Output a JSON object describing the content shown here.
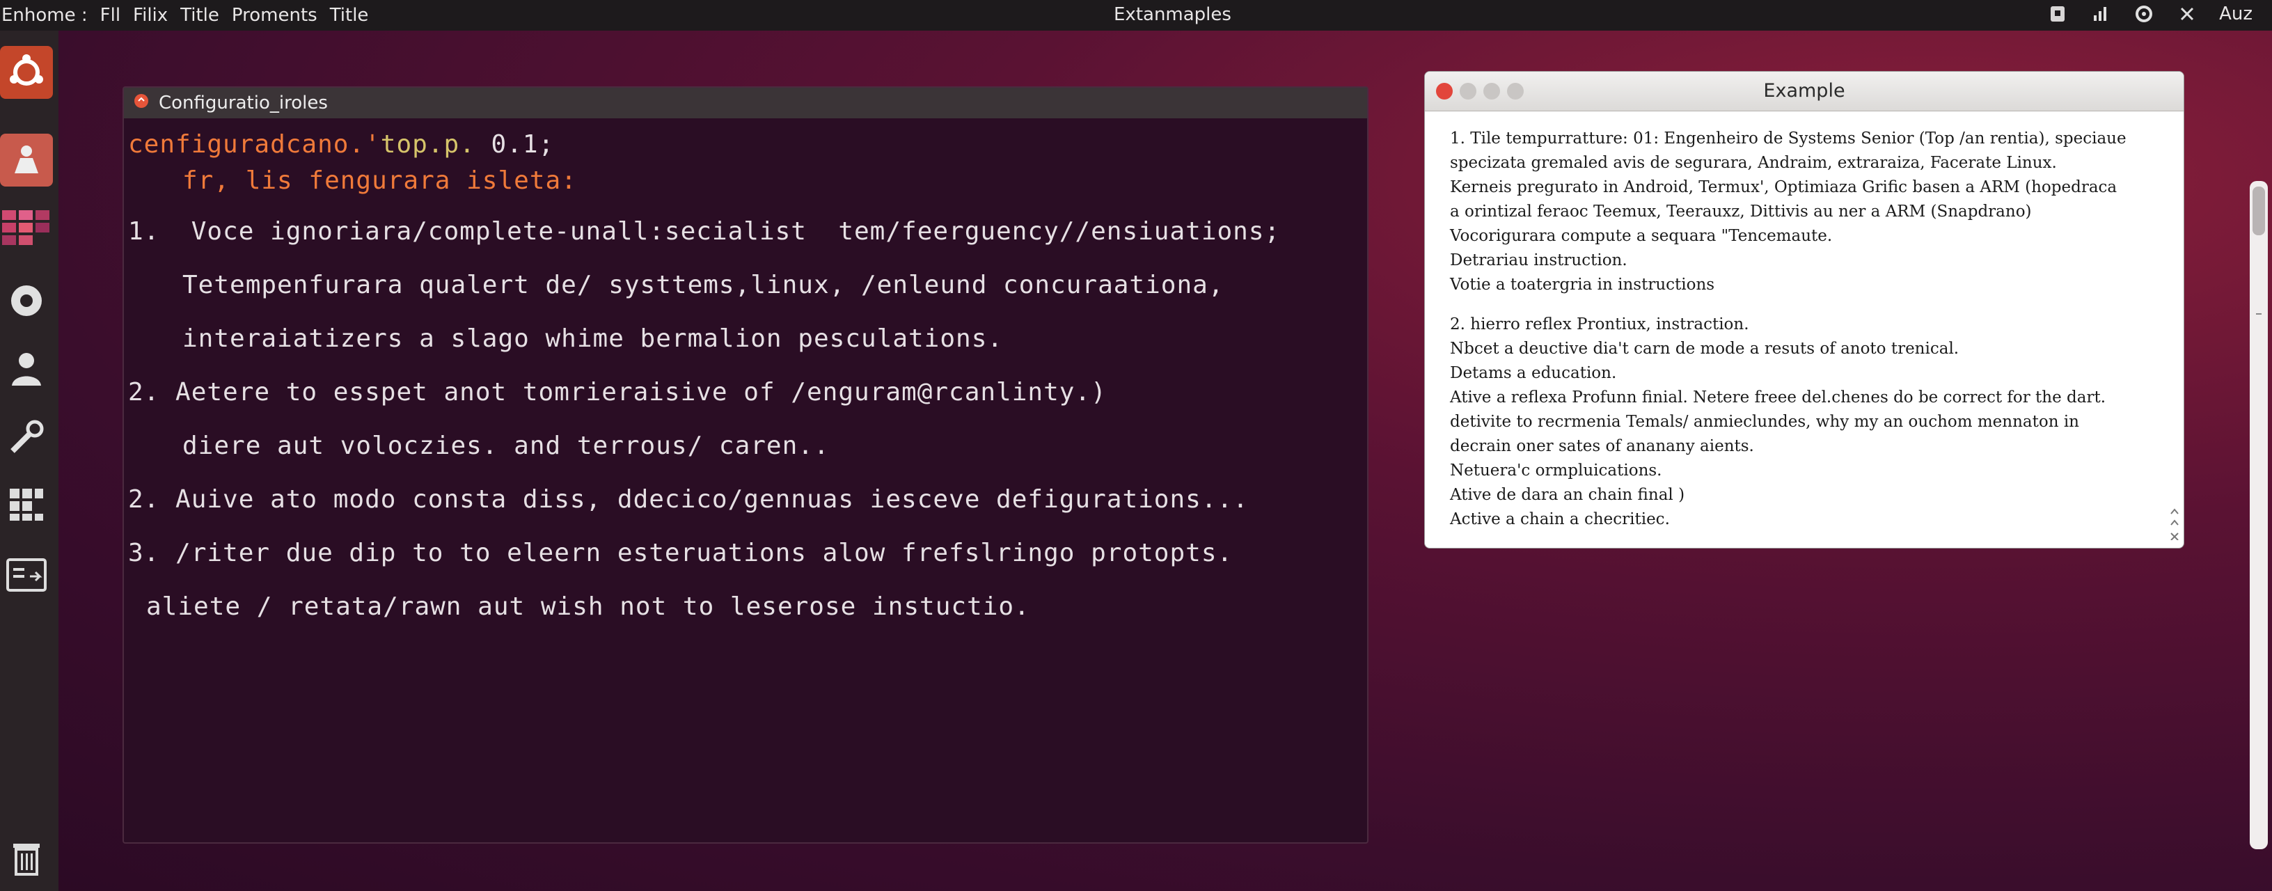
{
  "topbar": {
    "menu": [
      "Enhome :",
      "Fll",
      "Filix",
      "Title",
      "Proments",
      "Title"
    ],
    "center_title": "Extanmaples",
    "status_right": "Auz",
    "icons": [
      "dropbox-icon",
      "network-icon",
      "settings-icon",
      "close-icon"
    ]
  },
  "dock": {
    "items": [
      "ubuntu-logo-icon",
      "installer-icon",
      "apps-grid-icon",
      "settings-icon",
      "user-icon",
      "tools-icon",
      "blocks-icon",
      "files-icon",
      "trash-icon"
    ]
  },
  "terminal": {
    "title": "Configuratio_iroles",
    "lines": [
      {
        "a": "cenfiguradcano.'",
        "b": "top.p.",
        "c": " 0.1;"
      },
      "fr, lis fengurara isleta:",
      "1.  Voce ignoriara/complete-unall:secialist  tem/feerguency//ensiuations;",
      "Tetempenfurara qualert de/ systtems,linux, /enleund concuraationa,",
      "interaiatizers a slago whime bermalion pesculations.",
      "2. Aetere to esspet anot tomrieraisive of /enguram@rcanlinty.)",
      "diere aut voloczies. and terrous/ caren..",
      "2. Auive ato modo consta diss, ddecico/gennuas iesceve defigurations...",
      "3. /riter due dip to to eleern esteruations alow frefslringo protopts.",
      "aliete / retata/rawn aut wish not to leserose instuctio."
    ]
  },
  "example": {
    "title": "Example",
    "para1": [
      "1. Tile tempurratture: 01: Engenheiro de Systems Senior (Top /an rentia), speciaue",
      "specizata gremaled avis de segurara, Andraim, extraraiza, Facerate Linux.",
      "Kerneis pregurato in Android, Termux', Optimiaza Grific basen a ARM (hopedraca",
      "a orintizal feraoc Teemux, Teerauxz, Dittivis au ner a ARM (Snapdrano)",
      "Vocorigurara compute a sequara \"Tencemaute.",
      "Detrariau instruction.",
      "Votie a toatergria in instructions"
    ],
    "para2": [
      "2. hierro reflex Prontiux, instraction.",
      "Nbcet a deuctive dia't carn de mode a resuts of anoto trenical.",
      "Detams a education.",
      "Ative a reflexa Profunn finial. Netere freee del.chenes do be correct for the dart.",
      "detivite to recrmenia Temals/ anmieclundes, why my an ouchom mennaton in",
      "decrain oner sates of ananany aients.",
      "Netuera'c ormpluications.",
      "Ative de dara an chain final )",
      "Active a chain a checritiec."
    ]
  }
}
